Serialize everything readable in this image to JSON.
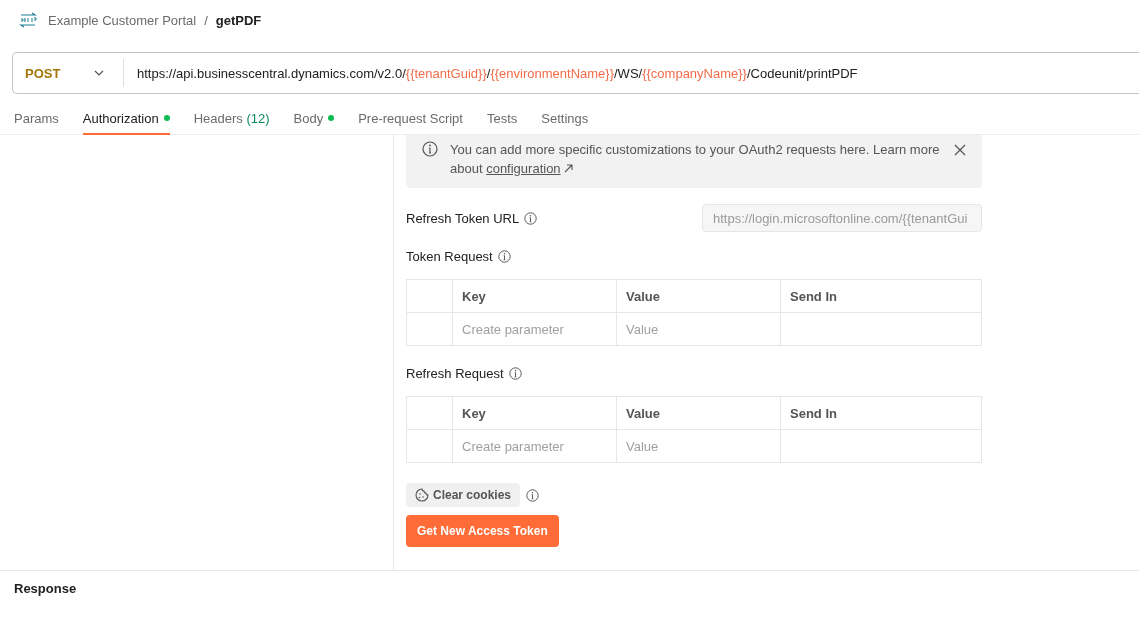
{
  "breadcrumb": {
    "collection": "Example Customer Portal",
    "separator": "/",
    "request": "getPDF"
  },
  "request": {
    "method": "POST",
    "url": [
      {
        "kind": "text",
        "text": "https://api.businesscentral.dynamics.com/v2.0/"
      },
      {
        "kind": "variable",
        "text": "{{tenantGuid}}"
      },
      {
        "kind": "text",
        "text": "/"
      },
      {
        "kind": "variable",
        "text": "{{environmentName}}"
      },
      {
        "kind": "text",
        "text": "/WS/"
      },
      {
        "kind": "variable",
        "text": "{{companyName}}"
      },
      {
        "kind": "text",
        "text": "/Codeunit/printPDF"
      }
    ]
  },
  "tabs": [
    {
      "label": "Params",
      "selected": false,
      "dot": false
    },
    {
      "label": "Authorization",
      "selected": true,
      "dot": true
    },
    {
      "label": "Headers",
      "count": "(12)",
      "selected": false,
      "dot": false
    },
    {
      "label": "Body",
      "selected": false,
      "dot": true
    },
    {
      "label": "Pre-request Script",
      "selected": false,
      "dot": false
    },
    {
      "label": "Tests",
      "selected": false,
      "dot": false
    },
    {
      "label": "Settings",
      "selected": false,
      "dot": false
    }
  ],
  "notice": {
    "text": "You can add more specific customizations to your OAuth2 requests here. Learn more about ",
    "link": "configuration"
  },
  "refresh_token_url": {
    "label": "Refresh Token URL",
    "placeholder": "https://login.microsoftonline.com/{{tenantGui"
  },
  "tables": [
    {
      "title": "Token Request",
      "columns": [
        "Key",
        "Value",
        "Send In"
      ],
      "placeholders": [
        "Create parameter",
        "Value"
      ]
    },
    {
      "title": "Refresh Request",
      "columns": [
        "Key",
        "Value",
        "Send In"
      ],
      "placeholders": [
        "Create parameter",
        "Value"
      ]
    }
  ],
  "buttons": {
    "clear_cookies": "Clear cookies",
    "get_token": "Get New Access Token"
  },
  "response": {
    "title": "Response"
  }
}
